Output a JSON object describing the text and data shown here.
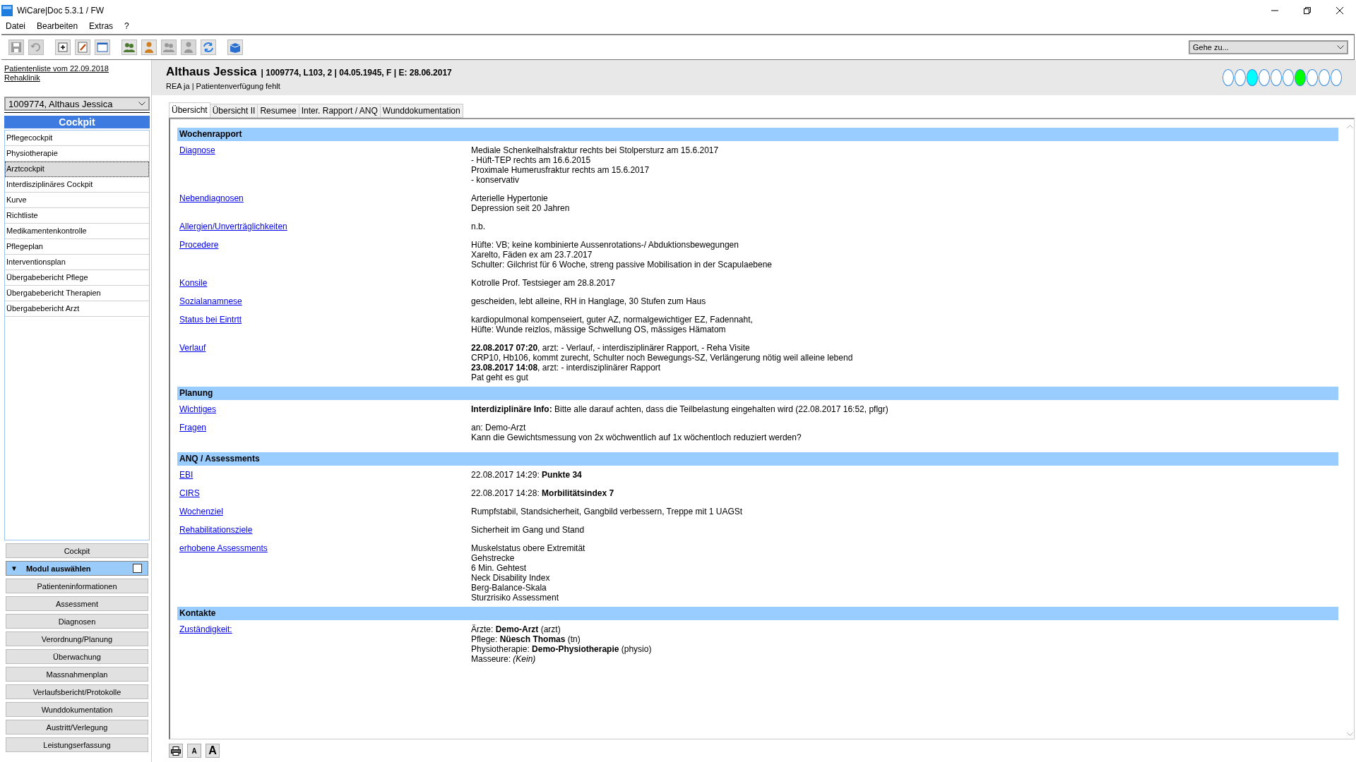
{
  "window": {
    "title": "WiCare|Doc 5.3.1  / FW"
  },
  "menu": [
    "Datei",
    "Bearbeiten",
    "Extras",
    "?"
  ],
  "toolbar": [
    {
      "kind": "save",
      "disabled": true
    },
    {
      "kind": "undo",
      "disabled": true
    },
    {
      "kind": "add",
      "disabled": false
    },
    {
      "kind": "edit",
      "disabled": false
    },
    {
      "kind": "window",
      "disabled": false
    },
    {
      "kind": "users",
      "disabled": false
    },
    {
      "kind": "user",
      "disabled": false
    },
    {
      "kind": "users",
      "disabled": true
    },
    {
      "kind": "user",
      "disabled": true
    },
    {
      "kind": "refresh",
      "disabled": false
    },
    {
      "kind": "box",
      "disabled": false
    }
  ],
  "goto": {
    "value": "Gehe zu..."
  },
  "patient": {
    "name": "Althaus Jessica",
    "details": "| 1009774, L103, 2 | 04.05.1945, F | E: 28.06.2017",
    "info": "REA ja | Patientenverfügung fehlt",
    "status_dots": [
      {
        "color": "#ffffff"
      },
      {
        "color": "#ffffff"
      },
      {
        "color": "#00ffff"
      },
      {
        "color": "#ffffff"
      },
      {
        "color": "#ffffff"
      },
      {
        "color": "#ffffff"
      },
      {
        "color": "#00ff00"
      },
      {
        "color": "#ffffff"
      },
      {
        "color": "#ffffff"
      },
      {
        "color": "#ffffff"
      }
    ]
  },
  "sidebar": {
    "list_link": "Patientenliste vom 22.09.2018",
    "clinic_link": "Rehaklinik",
    "patient_select": "1009774, Althaus Jessica",
    "header": "Cockpit",
    "items": [
      {
        "label": "Pflegecockpit",
        "selected": false
      },
      {
        "label": "Physiotherapie",
        "selected": false
      },
      {
        "label": "Arztcockpit",
        "selected": true
      },
      {
        "label": "Interdisziplinäres Cockpit",
        "selected": false
      },
      {
        "label": "Kurve",
        "selected": false
      },
      {
        "label": "Richtliste",
        "selected": false
      },
      {
        "label": "Medikamentenkontrolle",
        "selected": false
      },
      {
        "label": "Pflegeplan",
        "selected": false
      },
      {
        "label": "Interventionsplan",
        "selected": false
      },
      {
        "label": "Übergabebericht Pflege",
        "selected": false
      },
      {
        "label": "Übergabebericht Therapien",
        "selected": false
      },
      {
        "label": "Übergabebericht Arzt",
        "selected": false
      }
    ],
    "cockpit_button": "Cockpit",
    "module": {
      "toggle": "▼",
      "label": "Modul auswählen",
      "checked": false
    },
    "modules": [
      "Patienteninformationen",
      "Assessment",
      "Diagnosen",
      "Verordnung/Planung",
      "Überwachung",
      "Massnahmenplan",
      "Verlaufsbericht/Protokolle",
      "Wunddokumentation",
      "Austritt/Verlegung",
      "Leistungserfassung"
    ]
  },
  "tabs": [
    {
      "label": "Übersicht",
      "selected": true
    },
    {
      "label": "Übersicht II",
      "selected": false
    },
    {
      "label": "Resumee",
      "selected": false
    },
    {
      "label": "Inter. Rapport / ANQ",
      "selected": false
    },
    {
      "label": "Wunddokumentation",
      "selected": false
    }
  ],
  "sections": [
    {
      "title": "Wochenrapport",
      "rows": [
        {
          "key": "Diagnose",
          "lines": [
            "Mediale Schenkelhalsfraktur rechts bei Stolpersturz am 15.6.2017",
            "- Hüft-TEP rechts am 16.6.2015",
            "Proximale Humerusfraktur rechts am 15.6.2017",
            "- konservativ"
          ]
        },
        {
          "key": "Nebendiagnosen",
          "lines": [
            "Arterielle Hypertonie",
            "Depression seit 20 Jahren"
          ]
        },
        {
          "key": "Allergien/Unverträglichkeiten",
          "lines": [
            "n.b."
          ]
        },
        {
          "key": "Procedere",
          "lines": [
            "Hüfte: VB; keine kombinierte Aussenrotations-/ Abduktionsbewegungen",
            "Xarelto, Fäden ex am 23.7.2017",
            "Schulter: Gilchrist für 6 Woche, streng passive Mobilisation in der Scapulaebene"
          ]
        },
        {
          "key": "Konsile",
          "lines": [
            "Kotrolle Prof. Testsieger am 28.8.2017"
          ]
        },
        {
          "key": "Sozialanamnese",
          "lines": [
            "gescheiden, lebt alleine, RH in Hanglage, 30 Stufen zum Haus"
          ]
        },
        {
          "key": "Status bei Eintrtt",
          "lines": [
            "kardiopulmonal kompenseiert, guter AZ, normalgewichtiger EZ, Fadennaht,",
            "Hüfte: Wunde reizlos, mässige Schwellung OS, mässiges Hämatom"
          ]
        },
        {
          "key": "Verlauf",
          "lines": [
            "**22.08.2017 07:20**, arzt: - Verlauf, - interdisziplinärer Rapport, - Reha Visite",
            "CRP10, Hb106, kommt zurecht, Schulter noch Bewegungs-SZ, Verlängerung nötig weil alleine lebend",
            "**23.08.2017 14:08**, arzt: - interdisziplinärer Rapport",
            "Pat geht es gut"
          ]
        }
      ]
    },
    {
      "title": "Planung",
      "rows": [
        {
          "key": "Wichtiges",
          "lines": [
            "**Interdiziplinäre Info:** Bitte alle darauf achten, dass die Teilbelastung eingehalten wird (22.08.2017 16:52, pflgr)"
          ]
        },
        {
          "key": "Fragen",
          "lines": [
            "an: Demo-Arzt",
            "Kann die Gewichtsmessung von 2x wöchwentlich auf 1x wöchentloch reduziert werden?"
          ]
        }
      ]
    },
    {
      "title": "ANQ / Assessments",
      "rows": [
        {
          "key": "EBI",
          "lines": [
            "22.08.2017 14:29: **Punkte 34**"
          ]
        },
        {
          "key": "CIRS",
          "lines": [
            "22.08.2017 14:28: **Morbilitätsindex 7**"
          ]
        },
        {
          "key": "Wochenziel",
          "lines": [
            "Rumpfstabil, Standsicherheit, Gangbild verbessern, Treppe mit 1 UAGSt"
          ]
        },
        {
          "key": "Rehabilitationsziele",
          "lines": [
            "Sicherheit im Gang und Stand"
          ]
        },
        {
          "key": "erhobene Assessments",
          "lines": [
            "Muskelstatus obere Extremität",
            "Gehstrecke",
            "6 Min. Gehtest",
            "Neck Disability Index",
            "Berg-Balance-Skala",
            "Sturzrisiko Assessment"
          ]
        }
      ]
    },
    {
      "title": "Kontakte",
      "rows": [
        {
          "key": "Zuständigkeit:",
          "lines": [
            "Ärzte: **Demo-Arzt** (arzt)",
            "Pflege: **Nüesch Thomas** (tn)",
            "Physiotherapie: **Demo-Physiotherapie** (physio)",
            "Masseure: *(Kein)*"
          ]
        }
      ]
    }
  ],
  "footer_buttons": [
    {
      "kind": "print"
    },
    {
      "kind": "small",
      "label": "A"
    },
    {
      "kind": "large",
      "label": "A"
    }
  ]
}
